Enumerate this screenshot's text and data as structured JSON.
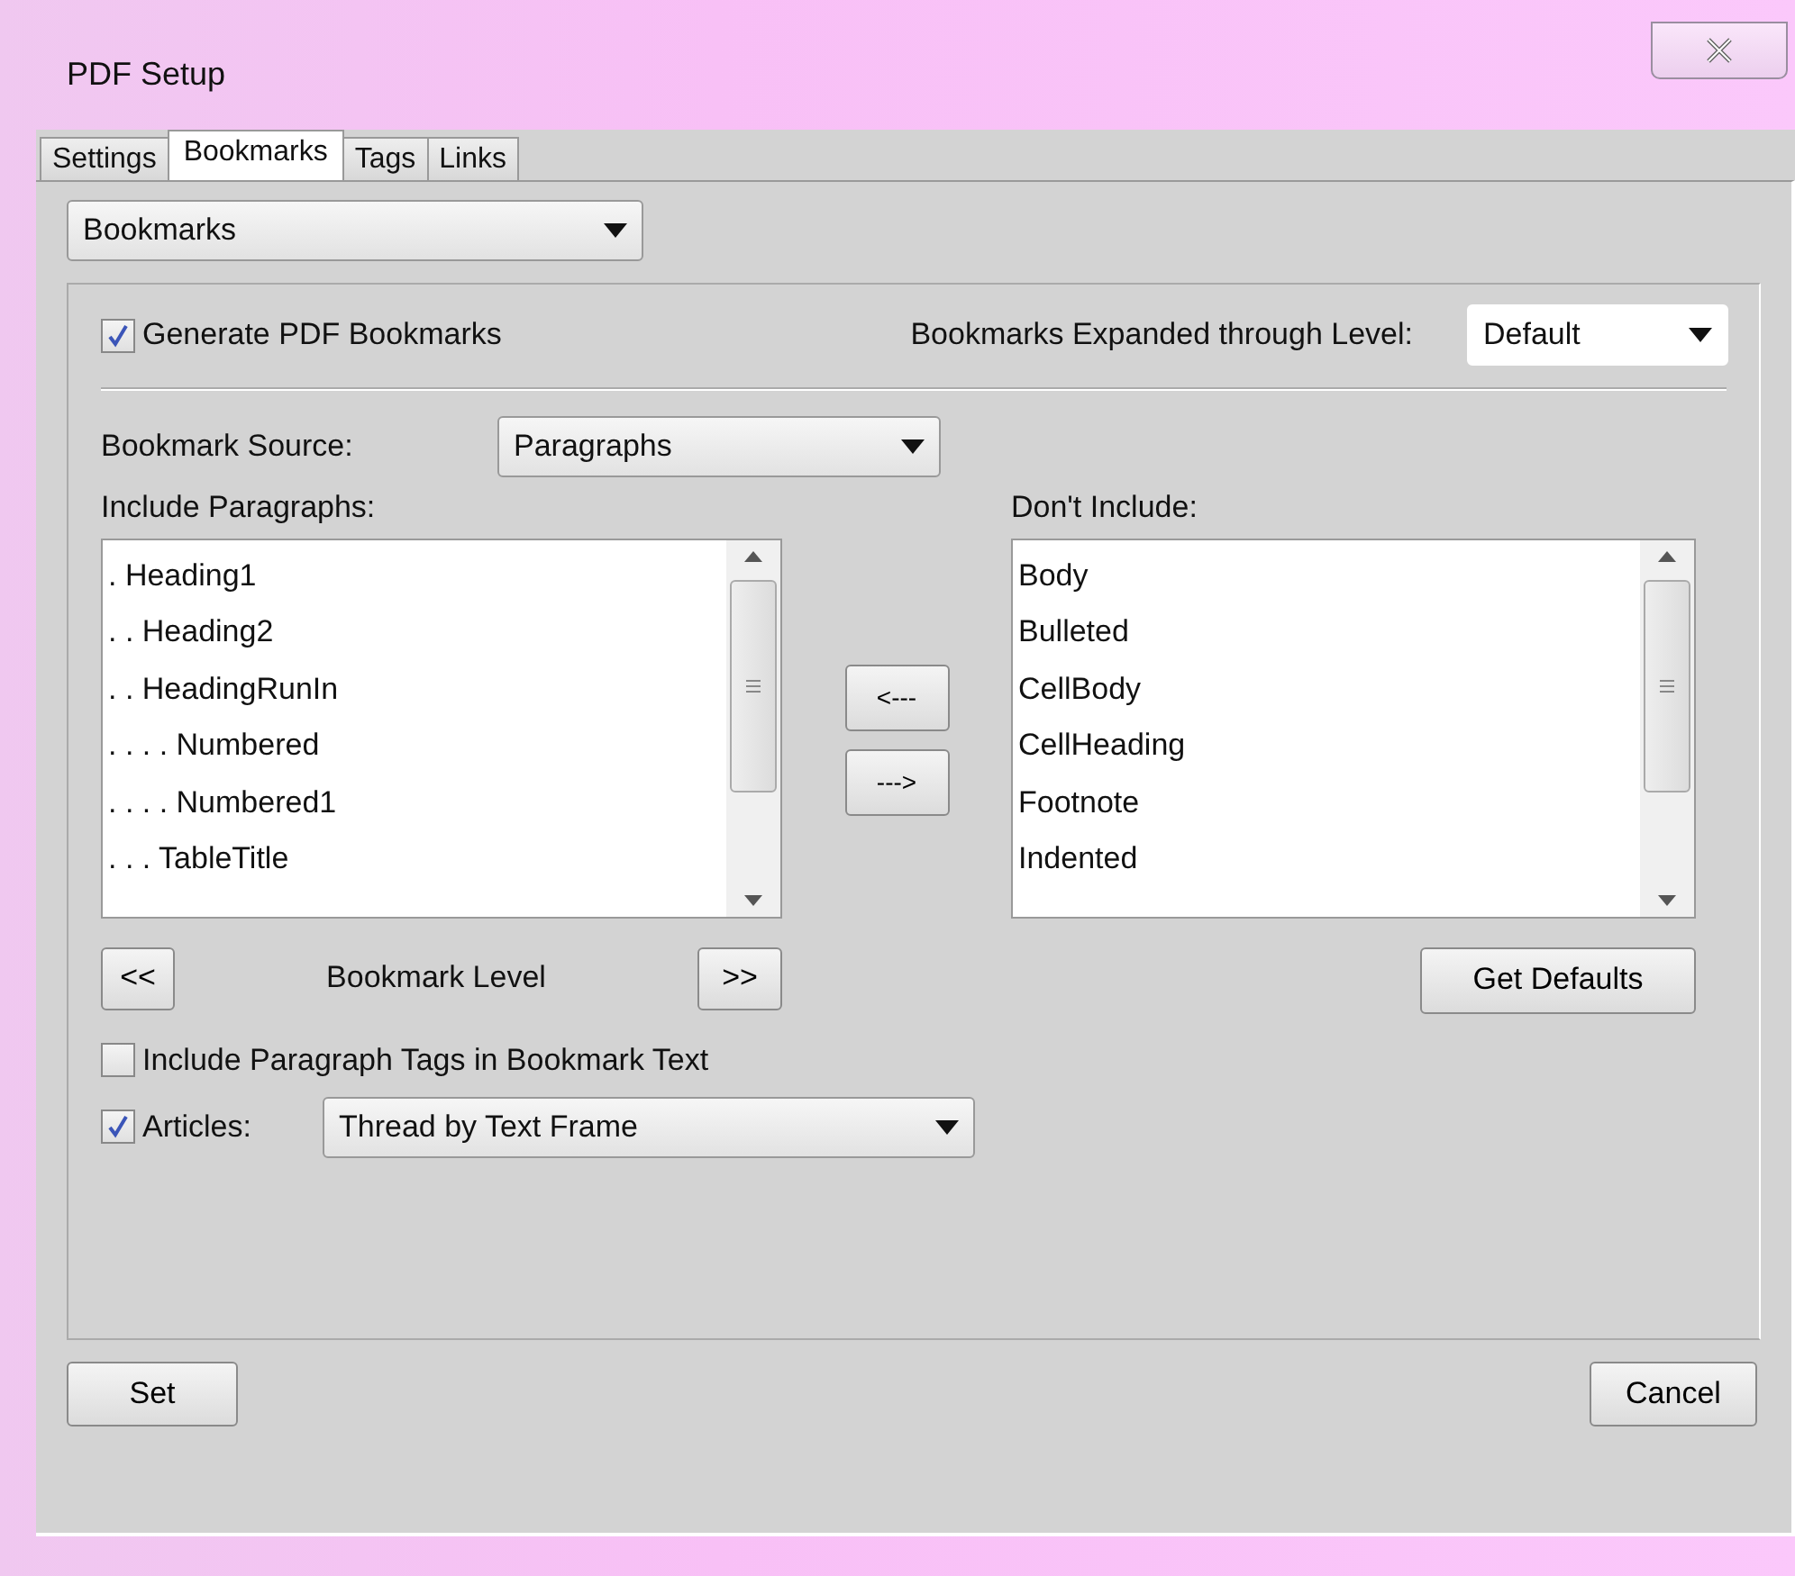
{
  "window": {
    "title": "PDF Setup"
  },
  "tabs": [
    {
      "label": "Settings",
      "selected": false
    },
    {
      "label": "Bookmarks",
      "selected": true
    },
    {
      "label": "Tags",
      "selected": false
    },
    {
      "label": "Links",
      "selected": false
    }
  ],
  "section_select": {
    "value": "Bookmarks"
  },
  "generate_bookmarks": {
    "label": "Generate PDF Bookmarks",
    "checked": true
  },
  "expanded_level": {
    "label": "Bookmarks Expanded through Level:",
    "value": "Default"
  },
  "bookmark_source": {
    "label": "Bookmark Source:",
    "value": "Paragraphs"
  },
  "include_list": {
    "label": "Include Paragraphs:",
    "items": [
      ". Heading1",
      ". . Heading2",
      ". . HeadingRunIn",
      ". . . . Numbered",
      ". . . . Numbered1",
      ". . . TableTitle"
    ]
  },
  "move_buttons": [
    "<---",
    "--->"
  ],
  "exclude_list": {
    "label": "Don't Include:",
    "items": [
      "Body",
      "Bulleted",
      "CellBody",
      "CellHeading",
      "Footnote",
      "Indented"
    ]
  },
  "level_controls": {
    "decrease": "<<",
    "label": "Bookmark Level",
    "increase": ">>"
  },
  "get_defaults": "Get Defaults",
  "include_tags": {
    "label": "Include Paragraph Tags in Bookmark Text",
    "checked": false
  },
  "articles": {
    "label": "Articles:",
    "checked": true,
    "value": "Thread by Text Frame"
  },
  "buttons": {
    "set": "Set",
    "cancel": "Cancel"
  }
}
